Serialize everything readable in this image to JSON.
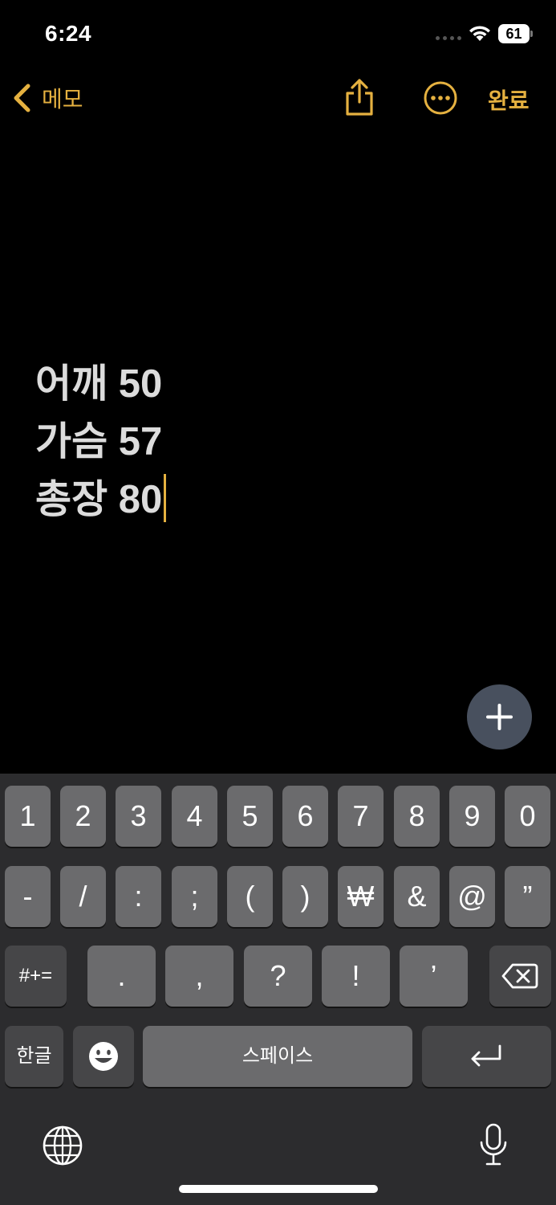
{
  "status_bar": {
    "time": "6:24",
    "battery": "61"
  },
  "nav": {
    "back_label": "메모",
    "done_label": "완료"
  },
  "note": {
    "lines": [
      "어깨 50",
      "가슴 57",
      "총장 80"
    ]
  },
  "keyboard": {
    "row1": [
      "1",
      "2",
      "3",
      "4",
      "5",
      "6",
      "7",
      "8",
      "9",
      "0"
    ],
    "row2": [
      "-",
      "/",
      ":",
      ";",
      "(",
      ")",
      "₩",
      "&",
      "@",
      "”"
    ],
    "row3": [
      ".",
      ",",
      "?",
      "!",
      "’"
    ],
    "symbols_key": "#+=",
    "lang_key": "한글",
    "space_key": "스페이스"
  },
  "colors": {
    "accent": "#e5b140",
    "keyboard_bg": "#2c2c2e",
    "key": "#6b6b6d",
    "key_dark": "#464648",
    "fab": "#48505e"
  },
  "icons": [
    "chevron-left-icon",
    "share-icon",
    "more-icon",
    "plus-icon",
    "delete-icon",
    "emoji-icon",
    "return-icon",
    "globe-icon",
    "mic-icon",
    "wifi-icon",
    "battery-icon"
  ]
}
